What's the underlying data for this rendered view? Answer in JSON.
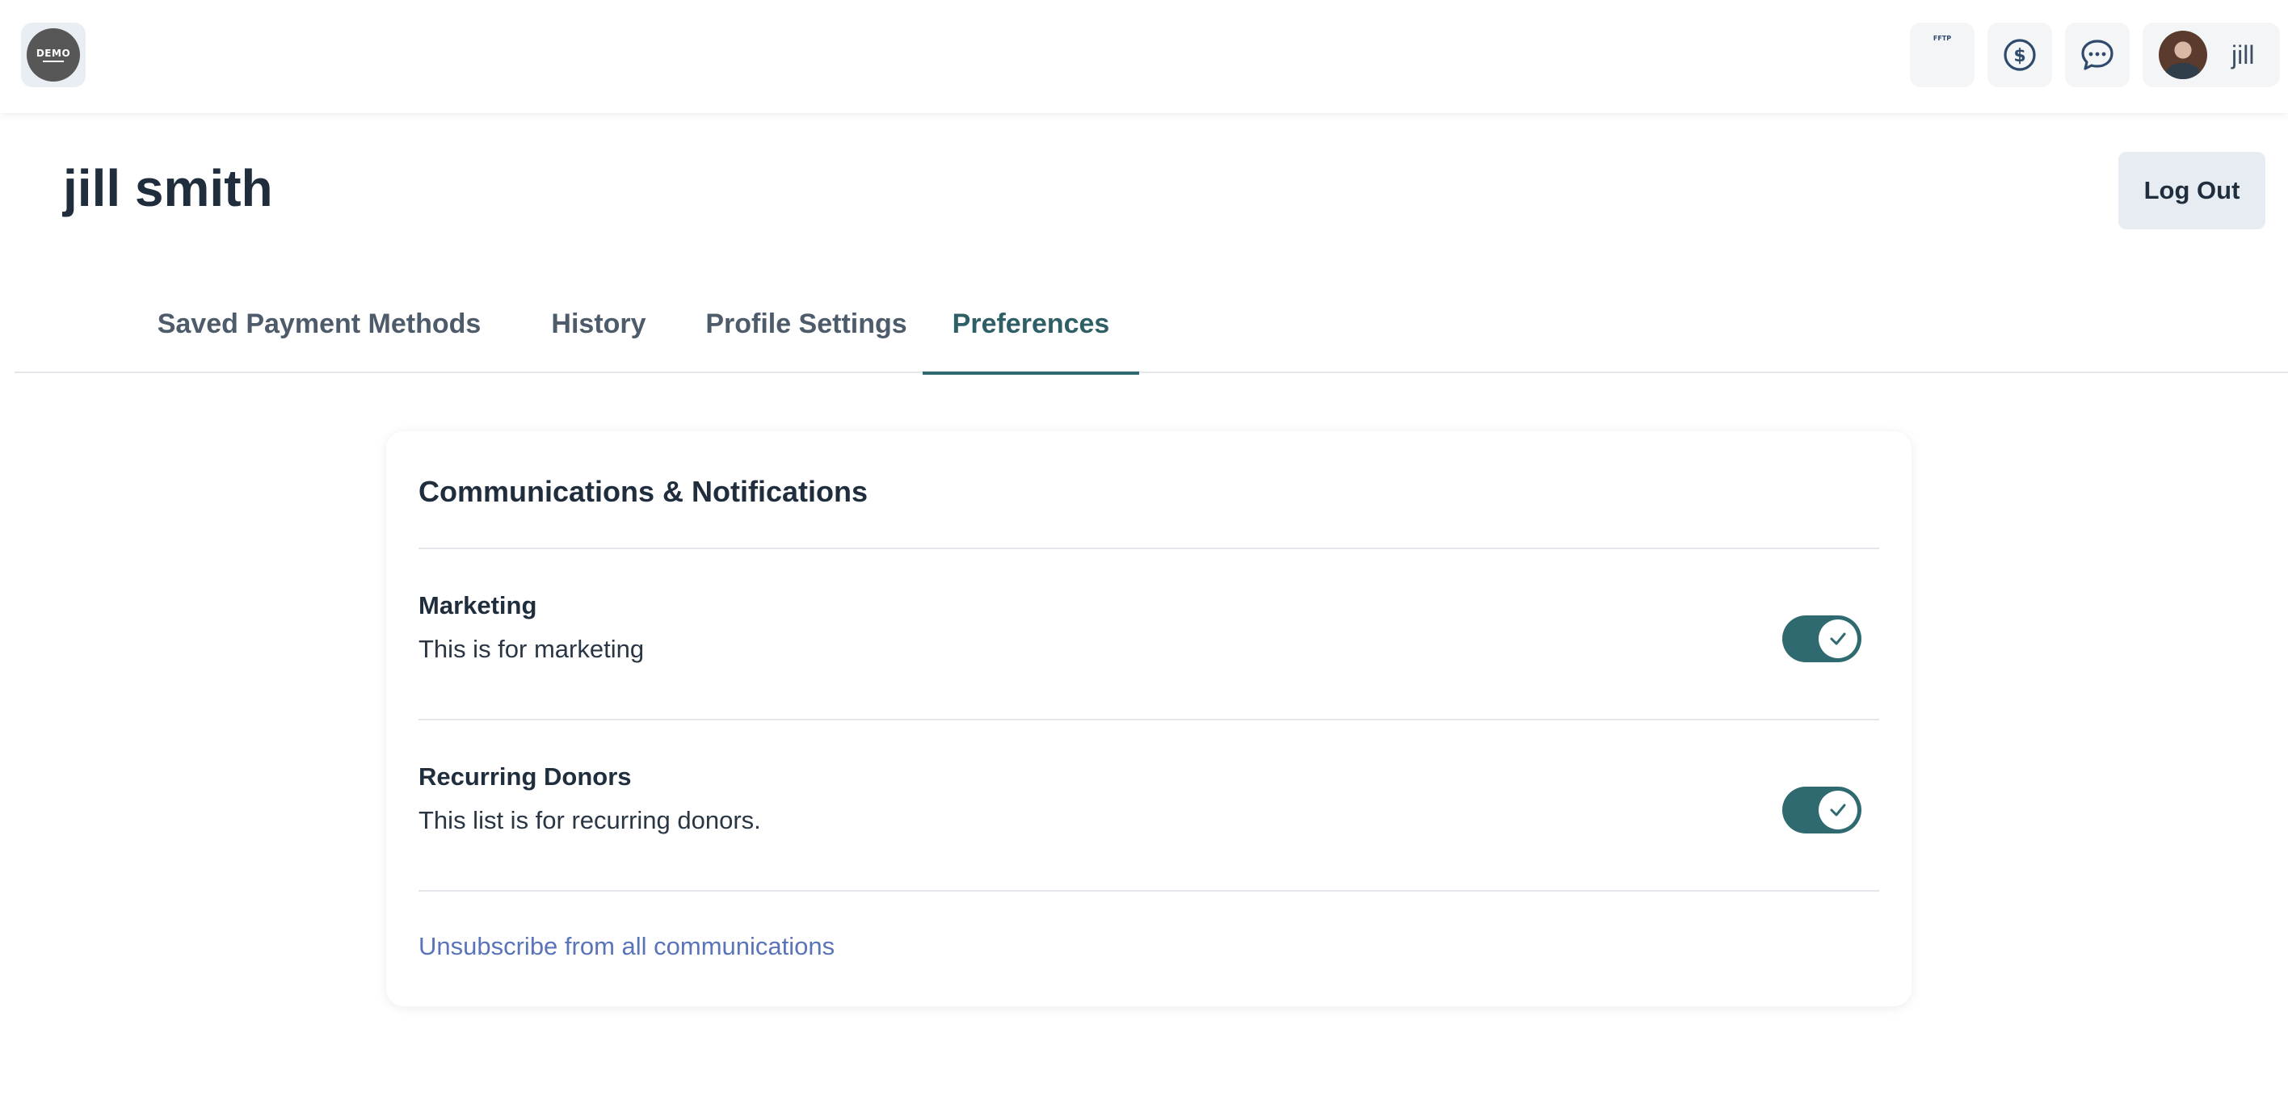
{
  "app": {
    "logo_text": "DEMO",
    "brand_mini_text": "FFTP",
    "user_name": "jill"
  },
  "header": {
    "title": "jill smith",
    "logout_label": "Log Out"
  },
  "tabs": [
    {
      "label": "Saved Payment Methods",
      "active": false
    },
    {
      "label": "History",
      "active": false
    },
    {
      "label": "Profile Settings",
      "active": false
    },
    {
      "label": "Preferences",
      "active": true
    }
  ],
  "card": {
    "title": "Communications & Notifications",
    "preferences": [
      {
        "name": "Marketing",
        "description": "This is for marketing",
        "enabled": true
      },
      {
        "name": "Recurring Donors",
        "description": "This list is for recurring donors.",
        "enabled": true
      }
    ],
    "unsubscribe_label": "Unsubscribe from all communications"
  },
  "icons": {
    "donate": "dollar-circle-icon",
    "messages": "chat-bubble-icon",
    "toggle_check": "check-icon"
  },
  "colors": {
    "accent": "#2f6a70",
    "link": "#5a74b8",
    "tile_bg": "#f3f5f7"
  }
}
